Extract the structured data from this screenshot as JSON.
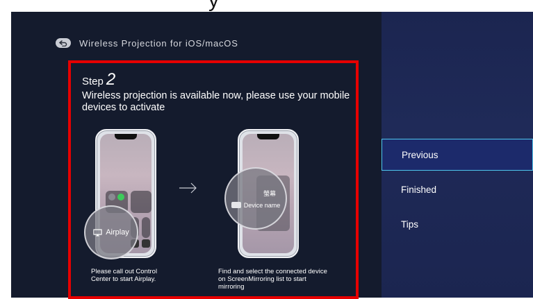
{
  "top_caption": "y",
  "header": {
    "back_icon": "back-arrow-icon",
    "title": "Wireless Projection for iOS/macOS"
  },
  "step": {
    "label": "Step",
    "number": "2",
    "instruction": "Wireless projection is available now, please use your mobile devices to activate"
  },
  "illustrations": {
    "left": {
      "magnifier_label": "Airplay",
      "caption": "Please call out Control Center to start Airplay."
    },
    "right": {
      "magnifier_top_label": "螢幕",
      "magnifier_label": "Device name",
      "caption": "Find and select the connected device on ScreenMirroring list to start mirroring"
    }
  },
  "menu": {
    "items": [
      {
        "label": "Previous",
        "selected": true
      },
      {
        "label": "Finished",
        "selected": false
      },
      {
        "label": "Tips",
        "selected": false
      }
    ]
  },
  "colors": {
    "background": "#141b2d",
    "panel": "#1f2a58",
    "highlight_border": "#e60000",
    "selected_border": "#4fc7ee"
  }
}
